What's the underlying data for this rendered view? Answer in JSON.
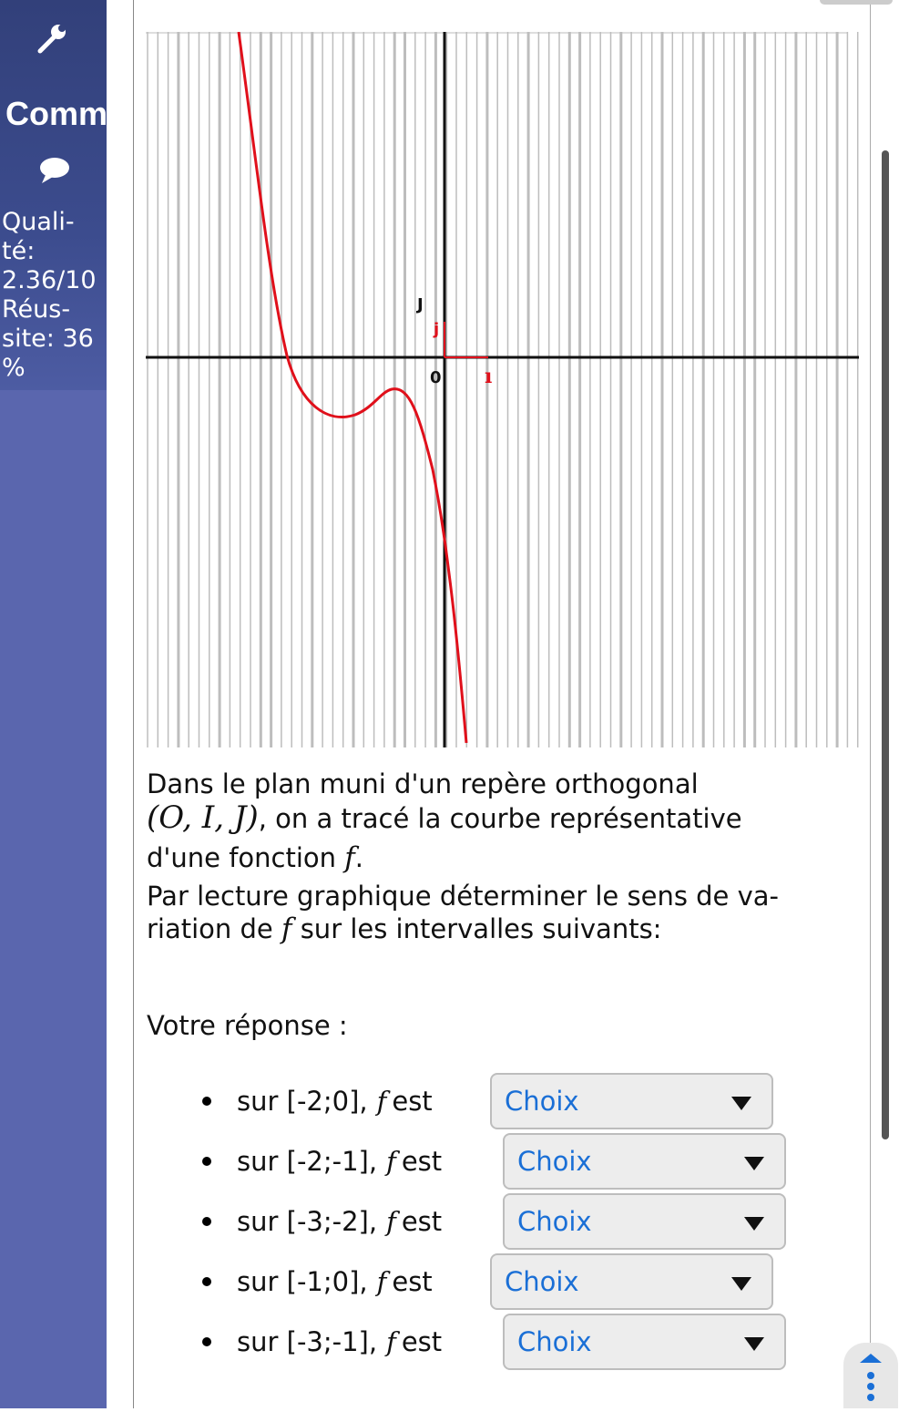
{
  "sidebar": {
    "icons": [
      "wrench-icon",
      "chat-bubble-icon"
    ],
    "title": "Comm",
    "stats": [
      "Quali-",
      "té:",
      "2.36/10",
      "Réus-",
      "site: 36",
      "%"
    ]
  },
  "graph": {
    "origin_label": "0",
    "j_label_black": "J",
    "j_label_red": "j",
    "i_label_red": "ı",
    "colors": {
      "curve": "#e0101b",
      "axis": "#111111",
      "grid": "#bdbdbd"
    }
  },
  "question": {
    "line1": "Dans le plan muni d'un repère orthogonal",
    "line2_math": "(O, I, J)",
    "line2_rest": ", on a tracé la courbe représentative",
    "line3_text": "d'une fonction ",
    "line3_f": "f",
    "line3_end": ".",
    "line4": "Par lecture graphique déterminer le sens de va-",
    "line5_a": "riation de ",
    "line5_f": "f",
    "line5_b": " sur les intervalles suivants:"
  },
  "answer": {
    "label": "Votre réponse :",
    "items": [
      {
        "prefix": "sur [-2;0], ",
        "f": "f",
        "suffix": "est",
        "select": "Choix"
      },
      {
        "prefix": "sur [-2;-1], ",
        "f": "f",
        "suffix": "est",
        "select": "Choix"
      },
      {
        "prefix": "sur [-3;-2], ",
        "f": "f",
        "suffix": "est",
        "select": "Choix"
      },
      {
        "prefix": "sur [-1;0], ",
        "f": "f",
        "suffix": "est",
        "select": "Choix"
      },
      {
        "prefix": "sur [-3;-1], ",
        "f": "f",
        "suffix": "est",
        "select": "Choix"
      }
    ]
  },
  "accent_color": "#1a6fd6",
  "sidebar_color": "#5a66ae"
}
